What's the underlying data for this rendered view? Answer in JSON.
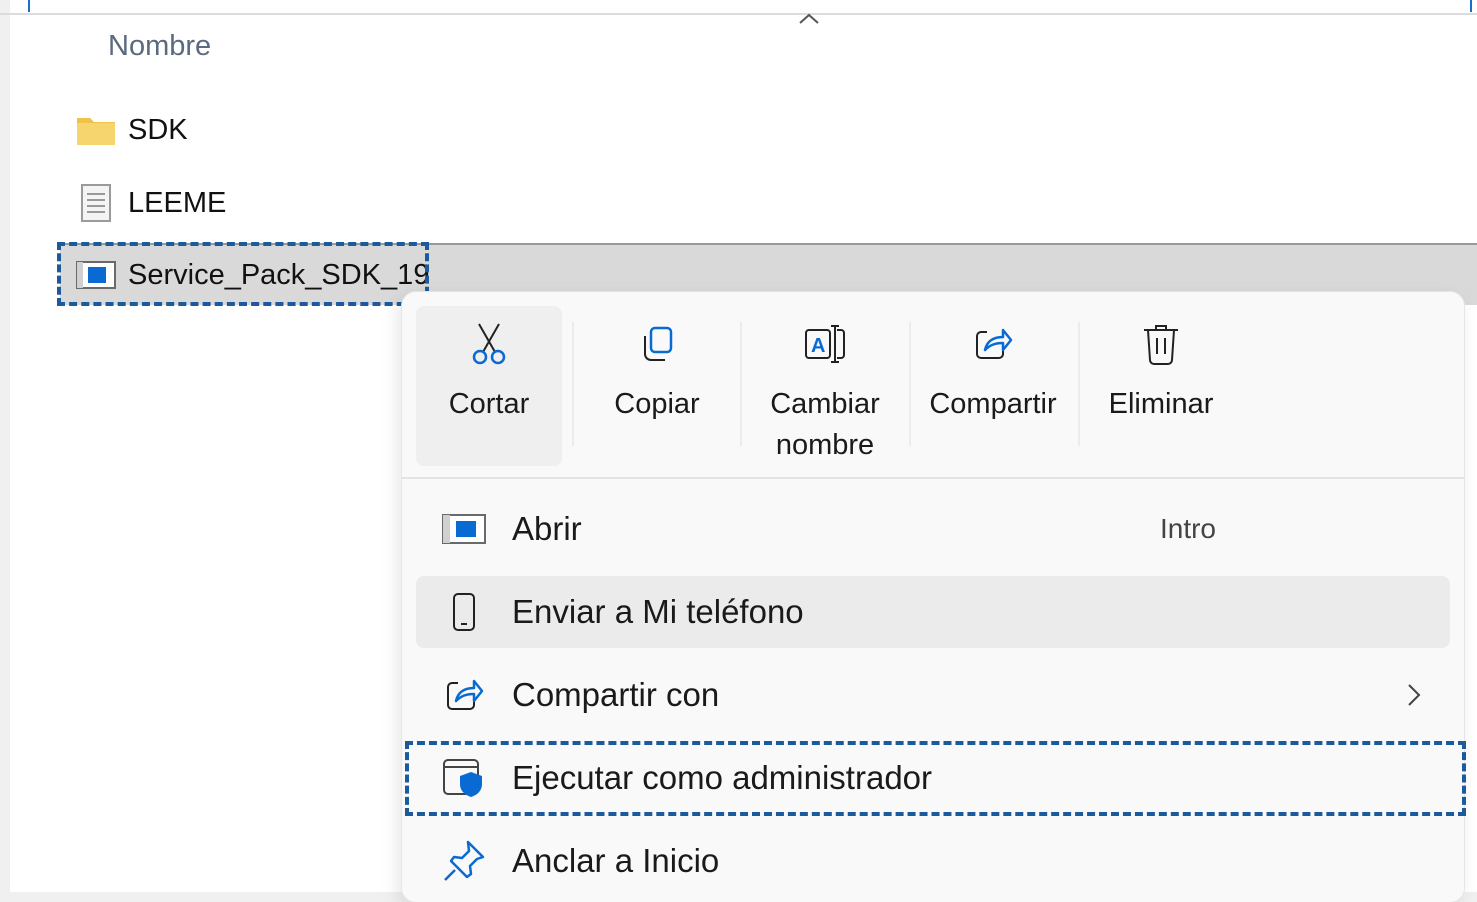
{
  "explorer": {
    "column_header": "Nombre",
    "files": [
      {
        "name": "SDK",
        "icon": "folder-icon"
      },
      {
        "name": "LEEME",
        "icon": "text-document-icon"
      },
      {
        "name": "Service_Pack_SDK_19",
        "icon": "application-icon",
        "selected": true
      }
    ]
  },
  "context_menu": {
    "toolbar": [
      {
        "label": "Cortar",
        "icon": "scissors-icon"
      },
      {
        "label": "Copiar",
        "icon": "copy-icon"
      },
      {
        "label": "Cambiar\nnombre",
        "icon": "rename-icon"
      },
      {
        "label": "Compartir",
        "icon": "share-icon"
      },
      {
        "label": "Eliminar",
        "icon": "trash-icon"
      }
    ],
    "items": [
      {
        "label": "Abrir",
        "shortcut": "Intro",
        "icon": "application-icon"
      },
      {
        "label": "Enviar a Mi teléfono",
        "icon": "phone-icon"
      },
      {
        "label": "Compartir con",
        "icon": "share-icon",
        "has_submenu": true
      },
      {
        "label": "Ejecutar como administrador",
        "icon": "shield-icon"
      },
      {
        "label": "Anclar a Inicio",
        "icon": "pin-icon"
      }
    ]
  },
  "colors": {
    "highlight_dash": "#1b5a9c",
    "accent": "#0a6ad4"
  }
}
